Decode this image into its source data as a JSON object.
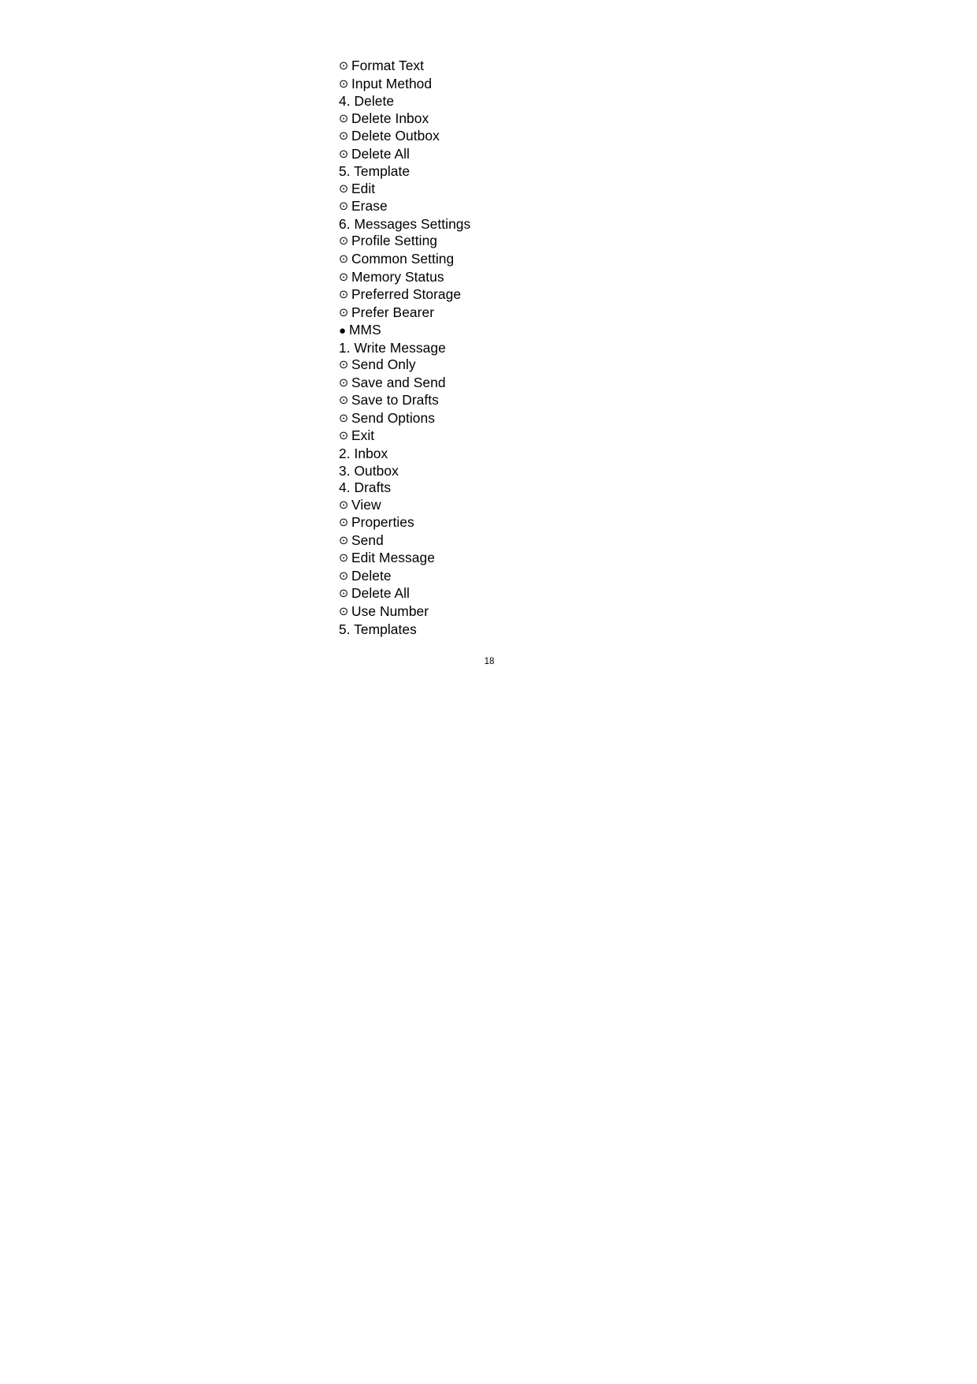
{
  "document": {
    "page_number": "18",
    "bullet_glyphs": {
      "sub_item": "⊙",
      "section": "●"
    }
  },
  "menu_lines": [
    {
      "type": "sub",
      "bullet": "⊙",
      "text": "Format Text"
    },
    {
      "type": "sub",
      "bullet": "⊙",
      "text": "Input Method"
    },
    {
      "type": "numbered",
      "bullet": "",
      "text": "4. Delete"
    },
    {
      "type": "sub",
      "bullet": "⊙",
      "text": "Delete Inbox"
    },
    {
      "type": "sub",
      "bullet": "⊙",
      "text": "Delete Outbox"
    },
    {
      "type": "sub",
      "bullet": "⊙",
      "text": "Delete All"
    },
    {
      "type": "numbered",
      "bullet": "",
      "text": "5. Template"
    },
    {
      "type": "sub",
      "bullet": "⊙",
      "text": "Edit"
    },
    {
      "type": "sub",
      "bullet": "⊙",
      "text": "Erase"
    },
    {
      "type": "numbered",
      "bullet": "",
      "text": "6. Messages Settings"
    },
    {
      "type": "sub",
      "bullet": "⊙",
      "text": "Profile Setting"
    },
    {
      "type": "sub",
      "bullet": "⊙",
      "text": "Common Setting"
    },
    {
      "type": "sub",
      "bullet": "⊙",
      "text": "Memory Status"
    },
    {
      "type": "sub",
      "bullet": "⊙",
      "text": "Preferred Storage"
    },
    {
      "type": "sub",
      "bullet": "⊙",
      "text": "Prefer Bearer"
    },
    {
      "type": "section",
      "bullet": "●",
      "text": "MMS"
    },
    {
      "type": "numbered",
      "bullet": "",
      "text": "1. Write Message"
    },
    {
      "type": "sub",
      "bullet": "⊙",
      "text": "Send Only"
    },
    {
      "type": "sub",
      "bullet": "⊙",
      "text": "Save and Send"
    },
    {
      "type": "sub",
      "bullet": "⊙",
      "text": "Save to Drafts"
    },
    {
      "type": "sub",
      "bullet": "⊙",
      "text": "Send Options"
    },
    {
      "type": "sub",
      "bullet": "⊙",
      "text": "Exit"
    },
    {
      "type": "numbered",
      "bullet": "",
      "text": "2. Inbox"
    },
    {
      "type": "numbered",
      "bullet": "",
      "text": "3. Outbox"
    },
    {
      "type": "numbered",
      "bullet": "",
      "text": "4. Drafts"
    },
    {
      "type": "sub",
      "bullet": "⊙",
      "text": "View"
    },
    {
      "type": "sub",
      "bullet": "⊙",
      "text": "Properties"
    },
    {
      "type": "sub",
      "bullet": "⊙",
      "text": "Send"
    },
    {
      "type": "sub",
      "bullet": "⊙",
      "text": "Edit Message"
    },
    {
      "type": "sub",
      "bullet": "⊙",
      "text": "Delete"
    },
    {
      "type": "sub",
      "bullet": "⊙",
      "text": "Delete All"
    },
    {
      "type": "sub",
      "bullet": "⊙",
      "text": "Use Number"
    },
    {
      "type": "numbered",
      "bullet": "",
      "text": "5. Templates"
    }
  ]
}
